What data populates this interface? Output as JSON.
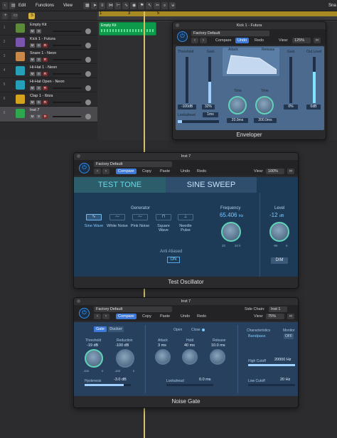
{
  "topbar": {
    "edit": "Edit",
    "functions": "Functions",
    "view": "View",
    "snap_label": "Sna",
    "s_badge": "S"
  },
  "ruler": {
    "markers": [
      "1",
      "3",
      "5"
    ]
  },
  "tracks": [
    {
      "num": "1",
      "name": "Empty Kit",
      "icon_color": "#5c8a3a",
      "show_r": false
    },
    {
      "num": "2",
      "name": "Kick 1 - Futura",
      "icon_color": "#7b54b0",
      "show_r": true
    },
    {
      "num": "3",
      "name": "Snare 1 - Neon",
      "icon_color": "#c9874a",
      "show_r": true
    },
    {
      "num": "4",
      "name": "Hi-Hat 1 - Neon",
      "icon_color": "#26a0b8",
      "show_r": true
    },
    {
      "num": "5",
      "name": "Hi-Hat Open - Neon",
      "icon_color": "#26a0b8",
      "show_r": true
    },
    {
      "num": "6",
      "name": "Clap 1 - Ibiza",
      "icon_color": "#d3a320",
      "show_r": true
    },
    {
      "num": "8",
      "name": "Inst 7",
      "icon_color": "#2fa74f",
      "show_r": true
    }
  ],
  "track_buttons": {
    "m": "M",
    "s": "S",
    "r": "R"
  },
  "region": {
    "label": "Empty Kit"
  },
  "enveloper": {
    "window_title": "Kick 1 - Futura",
    "preset": "Factory Default",
    "compare": "Compare",
    "undo": "Undo",
    "redo": "Redo",
    "view_label": "View:",
    "view_value": "125%",
    "threshold": "Threshold",
    "gain_left": "Gain",
    "attack": "Attack",
    "release": "Release",
    "gain_right": "Gain",
    "out_level": "Out Level",
    "threshold_val": "-100dB",
    "gain_left_val": "32%",
    "lookahead": "Lookahead",
    "lookahead_val": "1ms",
    "time_a": "Time",
    "time_a_val": "20.0ms",
    "time_r": "Time",
    "time_r_val": "200.0ms",
    "gain_right_val": "0%",
    "out_level_val": "0dB",
    "footer": "Enveloper"
  },
  "test_osc": {
    "window_title": "Inst 7",
    "preset": "Factory Default",
    "compare": "Compare",
    "copy": "Copy",
    "paste": "Paste",
    "undo": "Undo",
    "redo": "Redo",
    "view_label": "View:",
    "view_value": "100%",
    "tab_tone": "TEST TONE",
    "tab_sweep": "SINE SWEEP",
    "generator": "Generator",
    "waves": [
      {
        "label": "Sine Wave",
        "glyph": "∿",
        "on": true
      },
      {
        "label": "White Noise",
        "glyph": "⁓",
        "on": false
      },
      {
        "label": "Pink Noise",
        "glyph": "⁓",
        "on": false
      },
      {
        "label": "Square Wave",
        "glyph": "⊓",
        "on": false
      },
      {
        "label": "Needle Pulse",
        "glyph": "⊥",
        "on": false
      }
    ],
    "frequency_label": "Frequency",
    "frequency_val": "65.406",
    "frequency_unit": "Hz",
    "freq_min": "20",
    "freq_max": "20 k",
    "anti_aliased": "Anti Aliased",
    "on_btn": "ON",
    "level_label": "Level",
    "level_val": "-12",
    "level_unit": "dB",
    "level_min": "-96",
    "level_max": "6",
    "dim": "DIM",
    "footer": "Test Oscillator"
  },
  "noise_gate": {
    "window_title": "Inst 7",
    "preset": "Factory Default",
    "compare": "Compare",
    "copy": "Copy",
    "paste": "Paste",
    "undo": "Undo",
    "redo": "Redo",
    "sidechain_label": "Side Chain:",
    "sidechain_value": "Inst 1",
    "view_label": "View:",
    "view_value": "75%",
    "mode_gate": "Gate",
    "mode_ducker": "Ducker",
    "open": "Open",
    "close": "Close",
    "threshold": "Threshold",
    "threshold_val": "-19",
    "threshold_unit": "dB",
    "reduction": "Reduction",
    "reduction_val": "-100",
    "reduction_unit": "dB",
    "thr_min": "-100",
    "thr_max": "0",
    "red_min": "-100",
    "red_max": "0",
    "attack": "Attack",
    "attack_val": "3",
    "attack_unit": "ms",
    "hold": "Hold",
    "hold_val": "40",
    "hold_unit": "ms",
    "release": "Release",
    "release_val": "10.0",
    "release_unit": "ms",
    "characteristics": "Characteristics",
    "char_val": "Bandpass",
    "monitor": "Monitor",
    "monitor_val": "OFF",
    "hysteresis": "Hysteresis",
    "hysteresis_val": "-3.0",
    "hysteresis_unit": "dB",
    "lookahead": "Lookahead",
    "lookahead_val": "0.0",
    "lookahead_unit": "ms",
    "high_cutoff": "High Cutoff",
    "high_cutoff_val": "20000",
    "high_cutoff_unit": "Hz",
    "low_cutoff": "Low Cutoff",
    "low_cutoff_val": "20",
    "low_cutoff_unit": "Hz",
    "footer": "Noise Gate"
  }
}
